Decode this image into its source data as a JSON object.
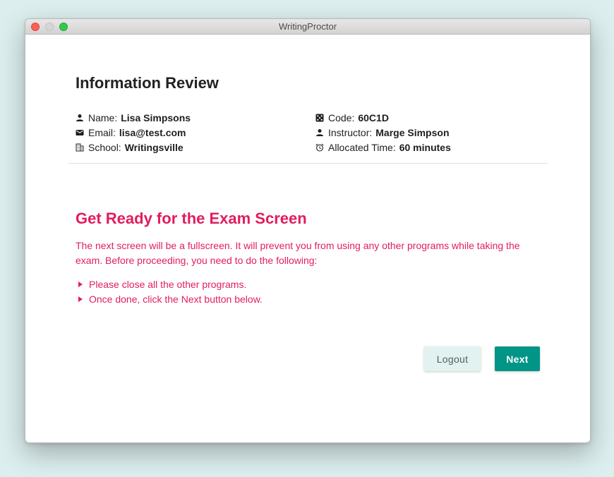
{
  "window": {
    "title": "WritingProctor"
  },
  "info_review": {
    "heading": "Information Review",
    "left_fields": [
      {
        "icon": "person-icon",
        "label": "Name:",
        "value": "Lisa Simpsons"
      },
      {
        "icon": "mail-icon",
        "label": "Email:",
        "value": "lisa@test.com"
      },
      {
        "icon": "building-icon",
        "label": "School:",
        "value": "Writingsville"
      }
    ],
    "right_fields": [
      {
        "icon": "dice-icon",
        "label": "Code:",
        "value": "60C1D"
      },
      {
        "icon": "person-icon",
        "label": "Instructor:",
        "value": "Marge Simpson"
      },
      {
        "icon": "alarm-clock-icon",
        "label": "Allocated Time:",
        "value": "60 minutes"
      }
    ]
  },
  "exam_prep": {
    "heading": "Get Ready for the Exam Screen",
    "description": "The next screen will be a fullscreen. It will prevent you from using any other programs while taking the exam. Before proceeding, you need to do the following:",
    "steps": [
      "Please close all the other programs.",
      "Once done, click the Next button below."
    ]
  },
  "actions": {
    "logout_label": "Logout",
    "next_label": "Next"
  },
  "colors": {
    "accent": "#e21d5c",
    "primary_button": "#009586",
    "secondary_button": "#e1f2f1"
  }
}
